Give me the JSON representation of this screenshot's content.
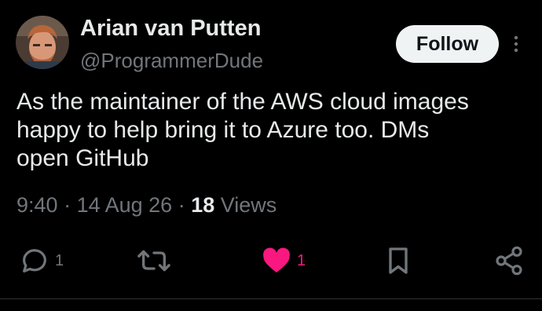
{
  "author": {
    "name": "Arian van Putten",
    "handle": "@ProgrammerDude"
  },
  "follow_label": "Follow",
  "tweet": {
    "text": "As the maintainer of the AWS cloud images\nhappy to help bring it to Azure too. DMs\nopen GitHub",
    "time": "9:40",
    "date": "14 Aug 26",
    "separator": " · ",
    "views_count": "18",
    "views_label": "Views"
  },
  "actions": {
    "reply_count": "1",
    "retweet_count": "",
    "like_count": "1"
  },
  "icons": {
    "reply": "reply-icon",
    "retweet": "retweet-icon",
    "like": "heart-icon",
    "bookmark": "bookmark-icon",
    "share": "share-icon",
    "more": "more-vertical-icon"
  },
  "colors": {
    "background": "#000000",
    "text": "#e7e9ea",
    "muted": "#71767b",
    "like": "#f91880",
    "follow_bg": "#eff3f4"
  }
}
